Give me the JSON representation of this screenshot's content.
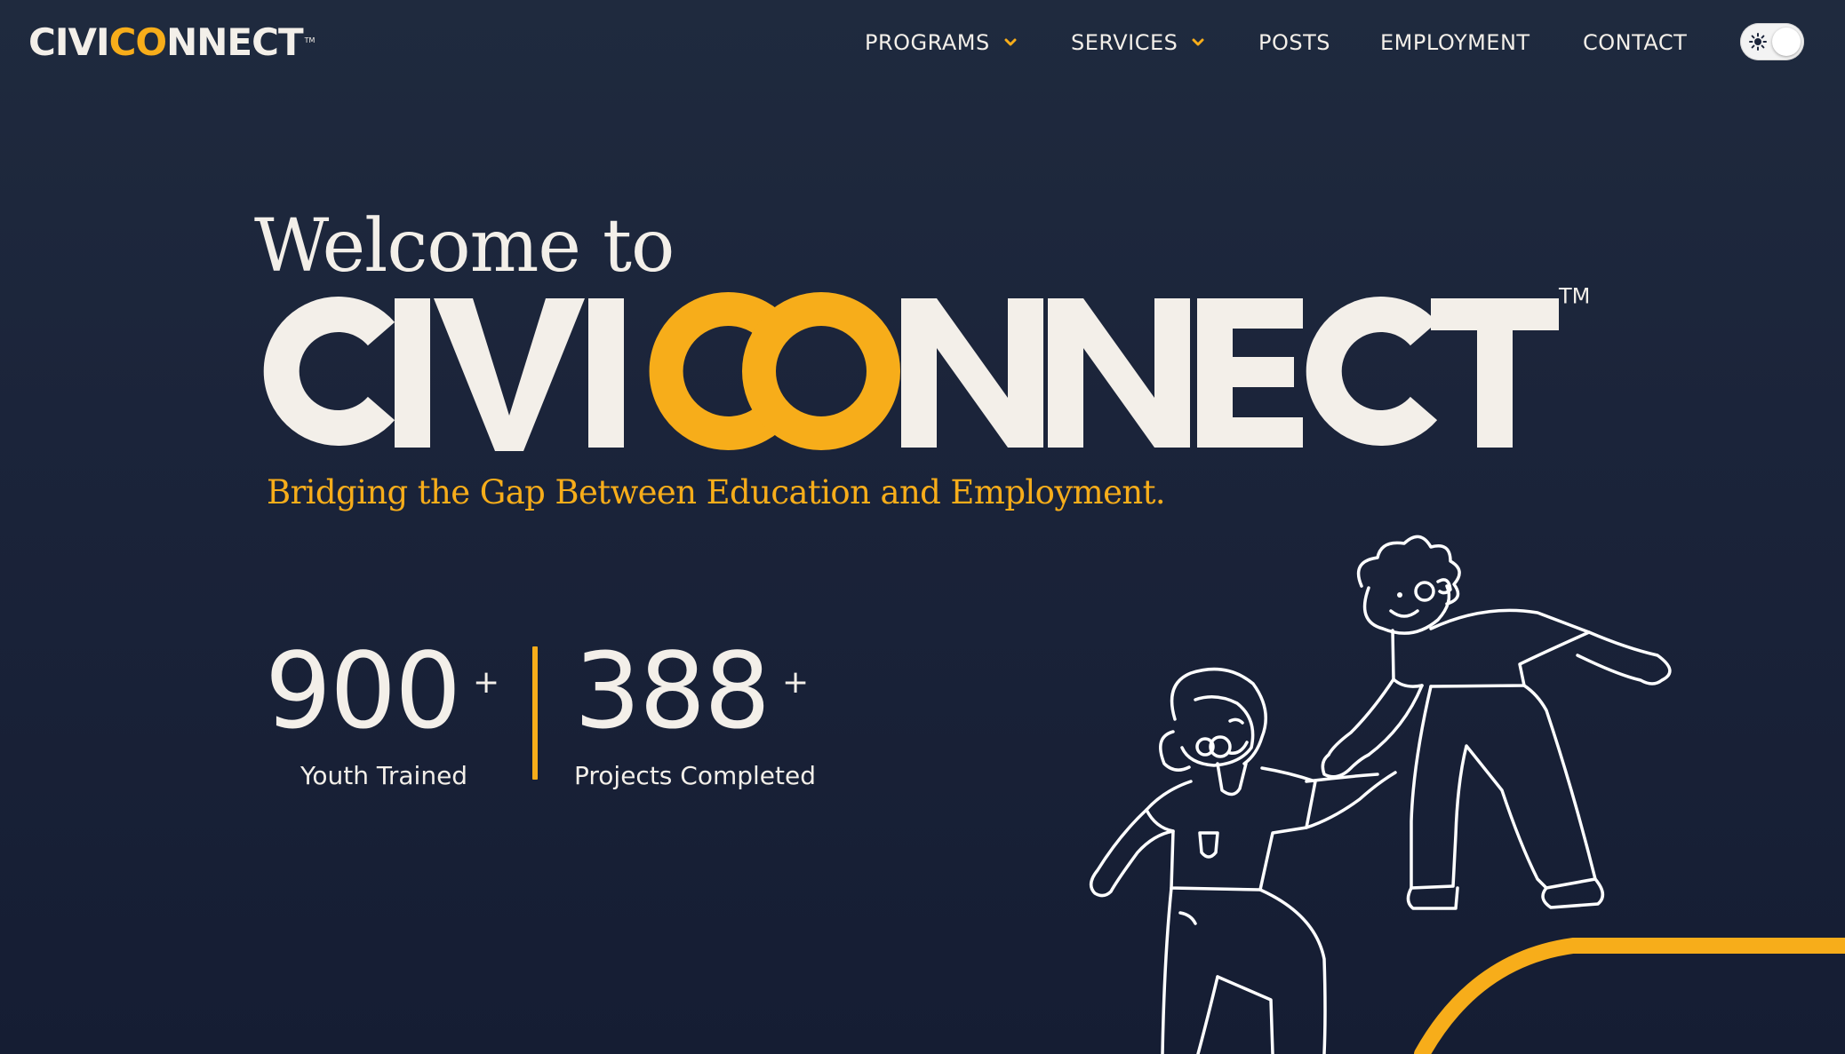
{
  "brand": {
    "logo_prefix": "CIVI",
    "logo_accent": "CO",
    "logo_suffix": "NNECT",
    "logo_tm": "TM",
    "accent_color": "#f7ad1a",
    "background_color": "#1b243a",
    "text_color": "#f3efe9"
  },
  "nav": {
    "items": [
      {
        "label": "PROGRAMS",
        "has_dropdown": true
      },
      {
        "label": "SERVICES",
        "has_dropdown": true
      },
      {
        "label": "POSTS",
        "has_dropdown": false
      },
      {
        "label": "EMPLOYMENT",
        "has_dropdown": false
      },
      {
        "label": "CONTACT",
        "has_dropdown": false
      }
    ],
    "theme_toggle_icon": "sun-icon"
  },
  "hero": {
    "welcome": "Welcome to",
    "wordmark": "CIVICONNECT",
    "wordmark_tm": "TM",
    "tagline": "Bridging the Gap Between Education and Employment."
  },
  "stats": [
    {
      "value": "900",
      "suffix": "+",
      "label": "Youth Trained"
    },
    {
      "value": "388",
      "suffix": "+",
      "label": "Projects Completed"
    }
  ]
}
